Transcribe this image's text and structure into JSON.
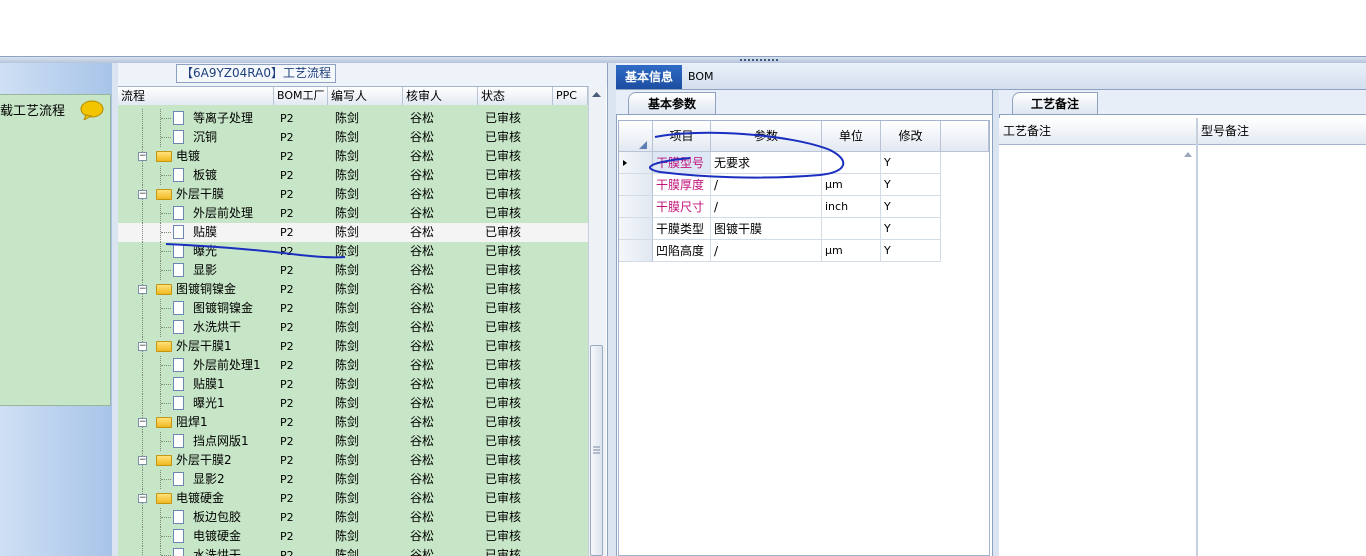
{
  "left_panel": {
    "label": "载工艺流程"
  },
  "tree_panel": {
    "title": "【6A9YZ04RA0】工艺流程",
    "columns": {
      "flow": "流程",
      "bom": "BOM工厂",
      "writer": "编写人",
      "reviewer": "核审人",
      "status": "状态",
      "ppc": "PPC"
    },
    "rows": [
      {
        "label": "等离子处理",
        "kind": "doc",
        "level": 2,
        "bom": "P2",
        "writer": "陈剑",
        "reviewer": "谷松",
        "status": "已审核"
      },
      {
        "label": "沉铜",
        "kind": "doc",
        "level": 2,
        "bom": "P2",
        "writer": "陈剑",
        "reviewer": "谷松",
        "status": "已审核"
      },
      {
        "label": "电镀",
        "kind": "folder",
        "level": 1,
        "bom": "P2",
        "writer": "陈剑",
        "reviewer": "谷松",
        "status": "已审核"
      },
      {
        "label": "板镀",
        "kind": "doc",
        "level": 2,
        "bom": "P2",
        "writer": "陈剑",
        "reviewer": "谷松",
        "status": "已审核"
      },
      {
        "label": "外层干膜",
        "kind": "folder",
        "level": 1,
        "bom": "P2",
        "writer": "陈剑",
        "reviewer": "谷松",
        "status": "已审核"
      },
      {
        "label": "外层前处理",
        "kind": "doc",
        "level": 2,
        "bom": "P2",
        "writer": "陈剑",
        "reviewer": "谷松",
        "status": "已审核"
      },
      {
        "label": "贴膜",
        "kind": "doc",
        "level": 2,
        "bom": "P2",
        "writer": "陈剑",
        "reviewer": "谷松",
        "status": "已审核",
        "selected": true
      },
      {
        "label": "曝光",
        "kind": "doc",
        "level": 2,
        "bom": "P2",
        "writer": "陈剑",
        "reviewer": "谷松",
        "status": "已审核"
      },
      {
        "label": "显影",
        "kind": "doc",
        "level": 2,
        "bom": "P2",
        "writer": "陈剑",
        "reviewer": "谷松",
        "status": "已审核"
      },
      {
        "label": "图镀铜镍金",
        "kind": "folder",
        "level": 1,
        "bom": "P2",
        "writer": "陈剑",
        "reviewer": "谷松",
        "status": "已审核"
      },
      {
        "label": "图镀铜镍金",
        "kind": "doc",
        "level": 2,
        "bom": "P2",
        "writer": "陈剑",
        "reviewer": "谷松",
        "status": "已审核"
      },
      {
        "label": "水洗烘干",
        "kind": "doc",
        "level": 2,
        "bom": "P2",
        "writer": "陈剑",
        "reviewer": "谷松",
        "status": "已审核"
      },
      {
        "label": "外层干膜1",
        "kind": "folder",
        "level": 1,
        "bom": "P2",
        "writer": "陈剑",
        "reviewer": "谷松",
        "status": "已审核"
      },
      {
        "label": "外层前处理1",
        "kind": "doc",
        "level": 2,
        "bom": "P2",
        "writer": "陈剑",
        "reviewer": "谷松",
        "status": "已审核"
      },
      {
        "label": "贴膜1",
        "kind": "doc",
        "level": 2,
        "bom": "P2",
        "writer": "陈剑",
        "reviewer": "谷松",
        "status": "已审核"
      },
      {
        "label": "曝光1",
        "kind": "doc",
        "level": 2,
        "bom": "P2",
        "writer": "陈剑",
        "reviewer": "谷松",
        "status": "已审核"
      },
      {
        "label": "阻焊1",
        "kind": "folder",
        "level": 1,
        "bom": "P2",
        "writer": "陈剑",
        "reviewer": "谷松",
        "status": "已审核"
      },
      {
        "label": "挡点网版1",
        "kind": "doc",
        "level": 2,
        "bom": "P2",
        "writer": "陈剑",
        "reviewer": "谷松",
        "status": "已审核"
      },
      {
        "label": "外层干膜2",
        "kind": "folder",
        "level": 1,
        "bom": "P2",
        "writer": "陈剑",
        "reviewer": "谷松",
        "status": "已审核"
      },
      {
        "label": "显影2",
        "kind": "doc",
        "level": 2,
        "bom": "P2",
        "writer": "陈剑",
        "reviewer": "谷松",
        "status": "已审核"
      },
      {
        "label": "电镀硬金",
        "kind": "folder",
        "level": 1,
        "bom": "P2",
        "writer": "陈剑",
        "reviewer": "谷松",
        "status": "已审核"
      },
      {
        "label": "板边包胶",
        "kind": "doc",
        "level": 2,
        "bom": "P2",
        "writer": "陈剑",
        "reviewer": "谷松",
        "status": "已审核"
      },
      {
        "label": "电镀硬金",
        "kind": "doc",
        "level": 2,
        "bom": "P2",
        "writer": "陈剑",
        "reviewer": "谷松",
        "status": "已审核"
      },
      {
        "label": "水洗烘干",
        "kind": "doc",
        "level": 2,
        "bom": "P2",
        "writer": "陈剑",
        "reviewer": "谷松",
        "status": "已审核"
      }
    ]
  },
  "right": {
    "tabs": {
      "basic": "基本信息",
      "bom": "BOM"
    },
    "params": {
      "tab": "基本参数",
      "columns": {
        "item": "项目",
        "param": "参数",
        "unit": "单位",
        "modify": "修改"
      },
      "rows": [
        {
          "item": "干膜型号",
          "param": "无要求",
          "unit": "",
          "modify": "Y",
          "pink": true,
          "current": true
        },
        {
          "item": "干膜厚度",
          "param": "/",
          "unit": "μm",
          "modify": "Y",
          "pink": true
        },
        {
          "item": "干膜尺寸",
          "param": "/",
          "unit": "inch",
          "modify": "Y",
          "pink": true
        },
        {
          "item": "干膜类型",
          "param": "图镀干膜",
          "unit": "",
          "modify": "Y",
          "pink": false
        },
        {
          "item": "凹陷高度",
          "param": "/",
          "unit": "μm",
          "modify": "Y",
          "pink": false
        }
      ]
    },
    "notes": {
      "tab": "工艺备注",
      "columns": {
        "process_note": "工艺备注",
        "model_note": "型号备注"
      }
    }
  },
  "colors": {
    "tree_bg": "#c7e6c7",
    "active_tab": "#1c4ea1",
    "pink_text": "#c0137a",
    "annotation_ink": "#1a2fbf"
  }
}
